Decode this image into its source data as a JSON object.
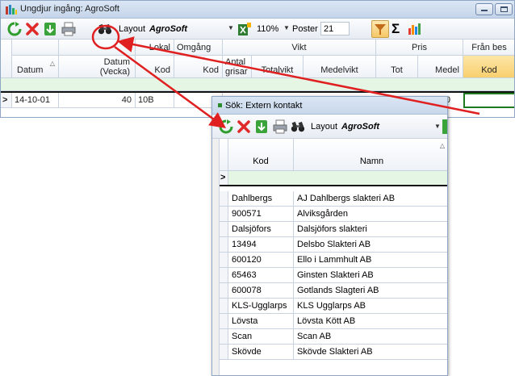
{
  "window": {
    "title": "Ungdjur ingång: AgroSoft"
  },
  "toolbar": {
    "layout_label": "Layout",
    "layout_value": "AgroSoft",
    "zoom_value": "110%",
    "poster_label": "Poster",
    "poster_value": "21"
  },
  "grid": {
    "group_headers": {
      "lokal": "Lokal",
      "omgang": "Omgång",
      "vikt": "Vikt",
      "pris": "Pris",
      "fran_bes": "Från bes"
    },
    "columns": {
      "datum": "Datum",
      "datum_vecka": "Datum\n(Vecka)",
      "lokal_kod": "Kod",
      "omgang_kod": "Kod",
      "antal_grisar": "Antal\ngrisar",
      "totalvikt": "Totalvikt",
      "medelvikt": "Medelvikt",
      "tot": "Tot",
      "medel": "Medel",
      "fran_kod": "Kod"
    },
    "current_row_marker": ">",
    "row": {
      "datum": "14-10-01",
      "vecka": "40",
      "lokal": "10B",
      "medel_tail": "00"
    }
  },
  "popup": {
    "title": "Sök: Extern kontakt",
    "layout_label": "Layout",
    "layout_value": "AgroSoft",
    "columns": {
      "kod": "Kod",
      "namn": "Namn"
    },
    "new_row_marker": ">",
    "rows": [
      {
        "kod": "Dahlbergs",
        "namn": "AJ Dahlbergs slakteri AB"
      },
      {
        "kod": "900571",
        "namn": "Alviksgården"
      },
      {
        "kod": "Dalsjöfors",
        "namn": "Dalsjöfors slakteri"
      },
      {
        "kod": "13494",
        "namn": "Delsbo Slakteri AB"
      },
      {
        "kod": "600120",
        "namn": "Ello i Lammhult AB"
      },
      {
        "kod": "65463",
        "namn": "Ginsten Slakteri AB"
      },
      {
        "kod": "600078",
        "namn": "Gotlands Slagteri AB"
      },
      {
        "kod": "KLS-Ugglarps",
        "namn": "KLS Ugglarps AB"
      },
      {
        "kod": "Lövsta",
        "namn": "Lövsta Kött AB"
      },
      {
        "kod": "Scan",
        "namn": "Scan AB"
      },
      {
        "kod": "Skövde",
        "namn": "Skövde Slakteri AB"
      }
    ]
  },
  "colors": {
    "annotation_red": "#e02020",
    "new_row_green": "#e6f6e4",
    "selected_header": "#f8cf6e"
  }
}
